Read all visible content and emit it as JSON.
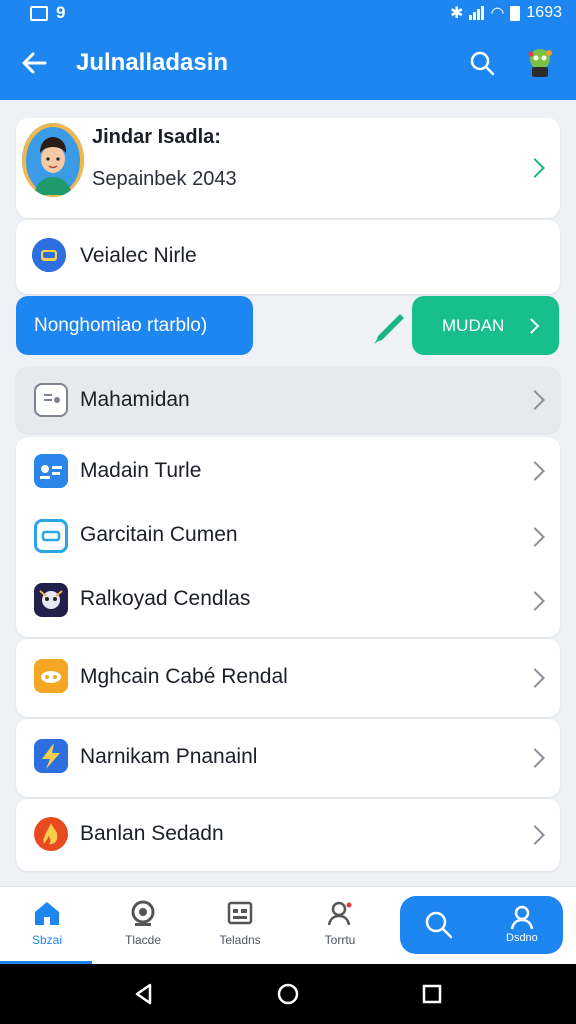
{
  "status_bar": {
    "left_text": "9",
    "time": "1693"
  },
  "app_bar": {
    "title": "Julnalladasin"
  },
  "profile": {
    "name": "Jindar Isadla:",
    "subtitle": "Sepainbek 2043"
  },
  "vehicle": {
    "label": "Veialec Nirle"
  },
  "action_pill": {
    "label": "Nonghomiao rtarblo)"
  },
  "action_button": {
    "label": "MUDAN"
  },
  "menu": {
    "highlighted": {
      "label": "Mahamidan",
      "icon": "card-icon"
    },
    "group1": [
      {
        "label": "Madain Turle",
        "icon": "id-card-icon"
      },
      {
        "label": "Garcitain Cumen",
        "icon": "tag-icon"
      },
      {
        "label": "Ralkoyad Cendlas",
        "icon": "character-icon"
      }
    ],
    "single": [
      {
        "label": "Mghcain Cabé Rendal",
        "icon": "cloud-icon"
      },
      {
        "label": "Narnikam Pnanainl",
        "icon": "lightning-icon"
      },
      {
        "label": "Banlan Sedadn",
        "icon": "flame-icon"
      }
    ]
  },
  "bottom_nav": {
    "items": [
      {
        "label": "Sbzai",
        "icon": "home-icon"
      },
      {
        "label": "Tlacde",
        "icon": "camera-icon"
      },
      {
        "label": "Teladns",
        "icon": "calendar-icon"
      },
      {
        "label": "Torrtu",
        "icon": "profile-icon"
      }
    ],
    "pill_label": "Dsdno"
  },
  "colors": {
    "primary": "#1e86f0",
    "accent_green": "#18be8e",
    "background": "#eef1f6"
  }
}
